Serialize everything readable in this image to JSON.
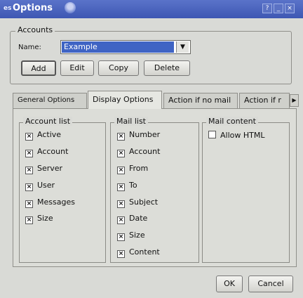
{
  "window": {
    "icon_text": "es",
    "title": "Options",
    "controls": [
      "?",
      "_",
      "×"
    ]
  },
  "accounts": {
    "legend": "Accounts",
    "name_label": "Name:",
    "selected_account": "Example",
    "buttons": {
      "add": "Add",
      "edit": "Edit",
      "copy": "Copy",
      "delete": "Delete"
    }
  },
  "tabs": [
    {
      "label": "General Options"
    },
    {
      "label": "Display Options",
      "active": true
    },
    {
      "label": "Action if no mail"
    },
    {
      "label": "Action if r"
    }
  ],
  "tab_scroll_icon": "chevron-right-icon",
  "display_options": {
    "account_list": {
      "legend": "Account list",
      "items": [
        {
          "label": "Active",
          "checked": true
        },
        {
          "label": "Account",
          "checked": true
        },
        {
          "label": "Server",
          "checked": true
        },
        {
          "label": "User",
          "checked": true
        },
        {
          "label": "Messages",
          "checked": true
        },
        {
          "label": "Size",
          "checked": true
        }
      ]
    },
    "mail_list": {
      "legend": "Mail list",
      "items": [
        {
          "label": "Number",
          "checked": true
        },
        {
          "label": "Account",
          "checked": true
        },
        {
          "label": "From",
          "checked": true
        },
        {
          "label": "To",
          "checked": true
        },
        {
          "label": "Subject",
          "checked": true
        },
        {
          "label": "Date",
          "checked": true
        },
        {
          "label": "Size",
          "checked": true
        },
        {
          "label": "Content",
          "checked": true
        }
      ]
    },
    "mail_content": {
      "legend": "Mail content",
      "items": [
        {
          "label": "Allow HTML",
          "checked": false
        }
      ]
    }
  },
  "footer": {
    "ok": "OK",
    "cancel": "Cancel"
  },
  "colors": {
    "titlebar": "#4a63bd",
    "selection": "#3f64c4",
    "window_bg": "#d9dad6"
  }
}
